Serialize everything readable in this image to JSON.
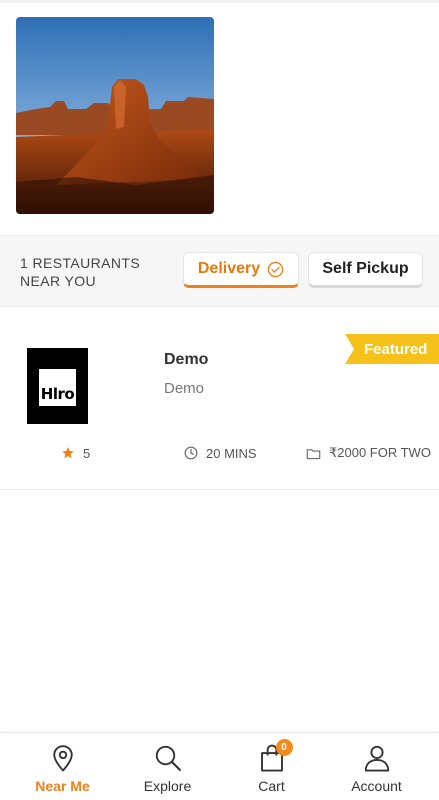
{
  "banner": {
    "image": "desert-butte-photo"
  },
  "listing": {
    "count_line1": "1 RESTAURANTS",
    "count_line2": "NEAR YOU",
    "tabs": {
      "delivery": "Delivery",
      "pickup": "Self Pickup"
    }
  },
  "restaurant": {
    "logo_text": "Hlro",
    "name": "Demo",
    "description": "Demo",
    "badge": "Featured",
    "rating": "5",
    "time": "20 MINS",
    "price": "₹2000 FOR TWO"
  },
  "nav": {
    "near_me": "Near Me",
    "explore": "Explore",
    "cart": "Cart",
    "cart_count": "0",
    "account": "Account"
  },
  "colors": {
    "accent": "#f0801a",
    "featured": "#f6c21a",
    "star": "#f0801a"
  }
}
